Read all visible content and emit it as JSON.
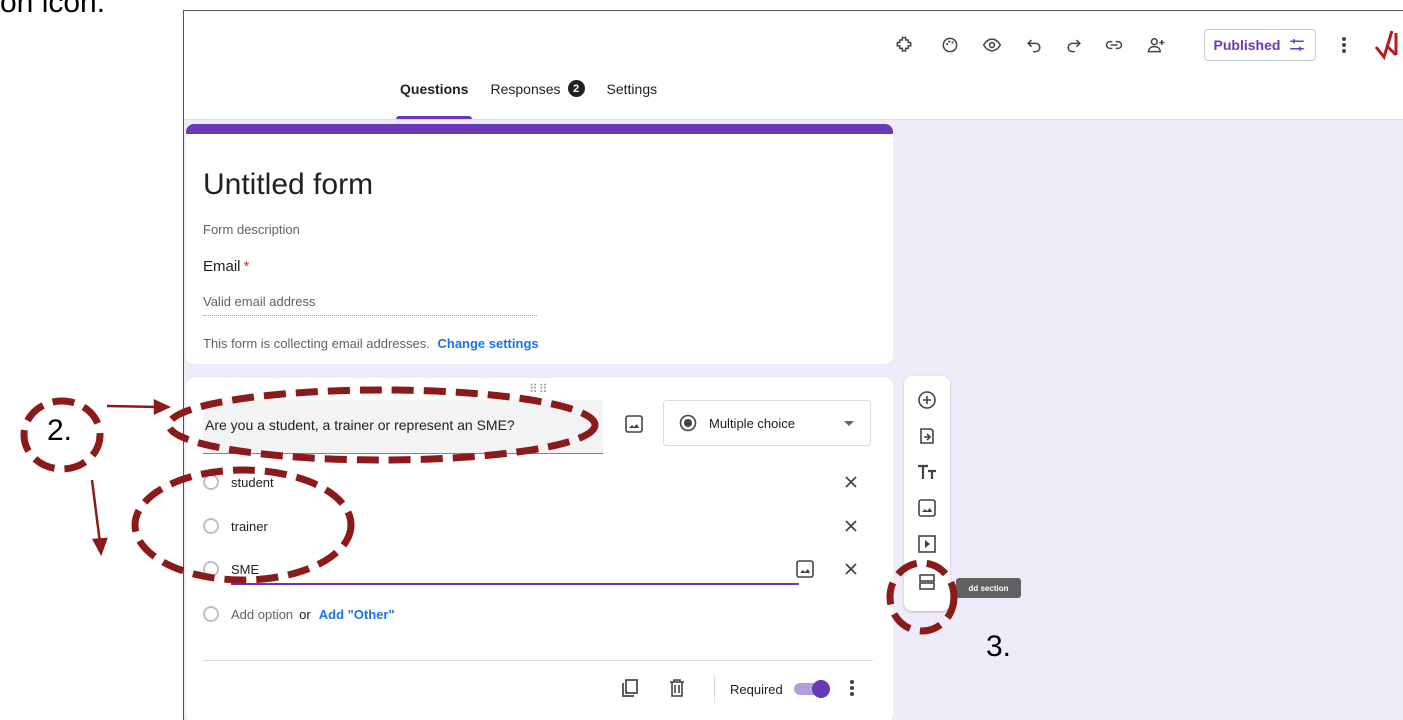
{
  "caption_fragment": "on icon.",
  "toolbar": {
    "icons": [
      "addon-icon",
      "palette-icon",
      "eye-icon",
      "undo-icon",
      "redo-icon",
      "link-icon",
      "person-add-icon"
    ],
    "publish_label": "Published",
    "colors": {
      "accent": "#673ab7",
      "link": "#1a73e8",
      "annotation": "#8b1a1a",
      "background": "#f0ebf8"
    }
  },
  "tabs": [
    {
      "label": "Questions",
      "active": true
    },
    {
      "label": "Responses",
      "badge": "2"
    },
    {
      "label": "Settings"
    }
  ],
  "form": {
    "title": "Untitled form",
    "description": "Form description",
    "email_label": "Email",
    "required_star": "*",
    "email_placeholder": "Valid email address",
    "collect_note": "This form is collecting email addresses.",
    "change_settings": "Change settings"
  },
  "question": {
    "title": "Are you a student, a trainer or represent an SME?",
    "type": "Multiple choice",
    "options": [
      "student",
      "trainer",
      "SME"
    ],
    "add_option": "Add option",
    "or": "or",
    "add_other": "Add \"Other\"",
    "required_label": "Required",
    "required_on": true
  },
  "side_toolbar": {
    "icons": [
      "add-question-icon",
      "import-questions-icon",
      "add-title-icon",
      "add-image-icon",
      "add-video-icon",
      "add-section-icon"
    ],
    "tooltip": "dd section"
  },
  "annotations": {
    "step2": "2.",
    "step3": "3."
  }
}
